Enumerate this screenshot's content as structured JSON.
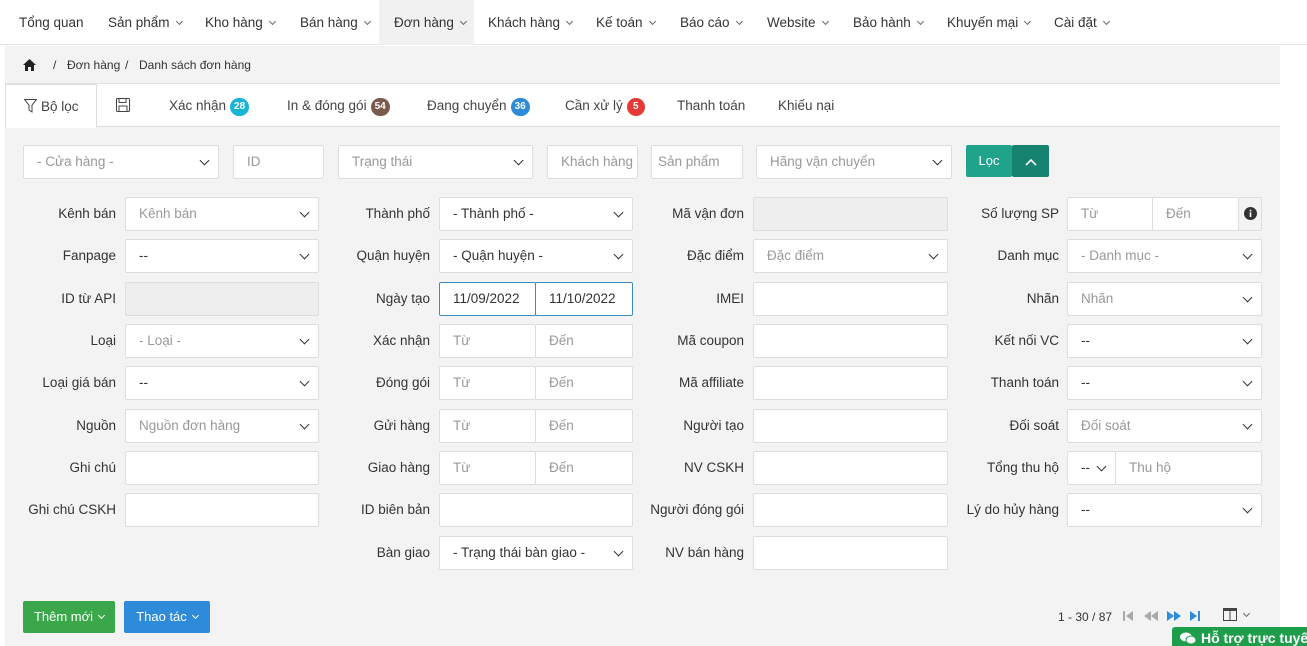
{
  "nav": [
    "Tổng quan",
    "Sản phẩm",
    "Kho hàng",
    "Bán hàng",
    "Đơn hàng",
    "Khách hàng",
    "Kế toán",
    "Báo cáo",
    "Website",
    "Bảo hành",
    "Khuyến mại",
    "Cài đặt"
  ],
  "breadcrumb": {
    "home_icon": "home-icon",
    "sep": "/",
    "orders": "Đơn hàng",
    "list": "Danh sách đơn hàng"
  },
  "tabs": {
    "filter": "Bộ lọc",
    "save_icon": "save-icon",
    "confirm": "Xác nhận",
    "confirm_count": "28",
    "confirm_color": "#17b4d6",
    "pack": "In & đóng gói",
    "pack_count": "54",
    "pack_color": "#7a5a4a",
    "shipping": "Đang chuyển",
    "shipping_count": "36",
    "shipping_color": "#2e8bd9",
    "handle": "Cần xử lý",
    "handle_count": "5",
    "handle_color": "#e53935",
    "payment": "Thanh toán",
    "complaint": "Khiếu nại"
  },
  "quick": {
    "store": "- Cửa hàng -",
    "id": "ID",
    "status": "Trạng thái",
    "customer": "Khách hàng",
    "product": "Sản phẩm",
    "carrier": "Hãng vận chuyển",
    "filter_btn": "Lọc",
    "accent": "#1fa38b"
  },
  "col1": {
    "channel_label": "Kênh bán",
    "channel": "Kênh bán",
    "fanpage_label": "Fanpage",
    "fanpage": "--",
    "api_label": "ID từ API",
    "type_label": "Loại",
    "type": "- Loại -",
    "price_label": "Loại giá bán",
    "price": "--",
    "source_label": "Nguồn",
    "source": "Nguồn đơn hàng",
    "note_label": "Ghi chú",
    "cs_note_label": "Ghi chú CSKH"
  },
  "col2": {
    "city_label": "Thành phố",
    "city": "- Thành phố -",
    "district_label": "Quận huyện",
    "district": "- Quận huyện -",
    "date_label": "Ngày tạo",
    "date_from": "11/09/2022",
    "date_to": "11/10/2022",
    "confirm_label": "Xác nhận",
    "pack_label": "Đóng gói",
    "send_label": "Gửi hàng",
    "deliver_label": "Giao hàng",
    "from": "Từ",
    "to": "Đến",
    "report_label": "ID biên bản",
    "handover_label": "Bàn giao",
    "handover": "- Trạng thái bàn giao -"
  },
  "col3": {
    "waybill_label": "Mã vận đơn",
    "feature_label": "Đặc điểm",
    "feature": "Đặc điểm",
    "imei_label": "IMEI",
    "coupon_label": "Mã coupon",
    "affiliate_label": "Mã affiliate",
    "creator_label": "Người tạo",
    "cs_staff_label": "NV CSKH",
    "packer_label": "Người đóng gói",
    "sales_label": "NV bán hàng"
  },
  "col4": {
    "qty_label": "Số lượng SP",
    "qty_from": "Từ",
    "qty_to": "Đến",
    "info_icon": "info-icon",
    "category_label": "Danh mục",
    "category": "- Danh mục -",
    "tag_label": "Nhãn",
    "tag": "Nhãn",
    "connect_label": "Kết nối VC",
    "connect": "--",
    "payment_label": "Thanh toán",
    "payment": "--",
    "reconcile_label": "Đối soát",
    "reconcile": "Đối soát",
    "cod_label": "Tổng thu hộ",
    "cod_op": "--",
    "cod": "Thu hộ",
    "cancel_label": "Lý do hủy hàng",
    "cancel": "--"
  },
  "footer": {
    "add": "Thêm mới",
    "add_color": "#3aa84a",
    "action": "Thao tác",
    "action_color": "#2e8bd9",
    "pager": "1 - 30 / 87",
    "columns_icon": "columns-icon",
    "support": "Hỗ trợ trực tuyến",
    "chat_icon": "chat-icon"
  }
}
